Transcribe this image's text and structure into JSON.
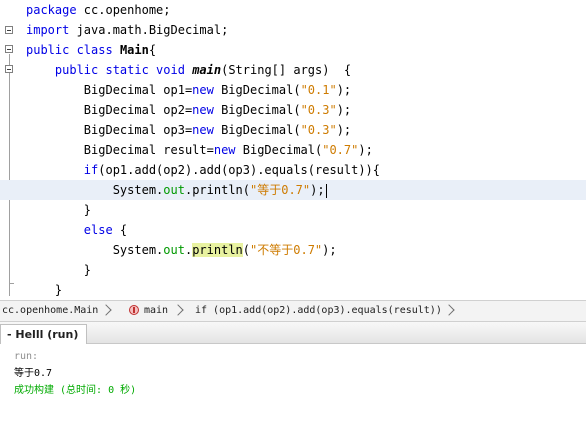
{
  "editor": {
    "lines": [
      {
        "parts": [
          {
            "t": "package",
            "c": "kw"
          },
          {
            "t": " cc.openhome;"
          }
        ]
      },
      {
        "parts": [
          {
            "t": "import",
            "c": "kw"
          },
          {
            "t": " java.math.BigDecimal;"
          }
        ]
      },
      {
        "parts": [
          {
            "t": "public class",
            "c": "kw"
          },
          {
            "t": " "
          },
          {
            "t": "Main",
            "c": "cls"
          },
          {
            "t": "{"
          }
        ]
      },
      {
        "parts": [
          {
            "t": "    public static void",
            "c": "kw"
          },
          {
            "t": " "
          },
          {
            "t": "main",
            "c": "fn"
          },
          {
            "t": "(String[] args)  {"
          }
        ]
      },
      {
        "parts": [
          {
            "t": "        BigDecimal op1="
          },
          {
            "t": "new",
            "c": "kw"
          },
          {
            "t": " BigDecimal("
          },
          {
            "t": "\"0.1\"",
            "c": "str"
          },
          {
            "t": ");"
          }
        ]
      },
      {
        "parts": [
          {
            "t": "        BigDecimal op2="
          },
          {
            "t": "new",
            "c": "kw"
          },
          {
            "t": " BigDecimal("
          },
          {
            "t": "\"0.3\"",
            "c": "str"
          },
          {
            "t": ");"
          }
        ]
      },
      {
        "parts": [
          {
            "t": "        BigDecimal op3="
          },
          {
            "t": "new",
            "c": "kw"
          },
          {
            "t": " BigDecimal("
          },
          {
            "t": "\"0.3\"",
            "c": "str"
          },
          {
            "t": ");"
          }
        ]
      },
      {
        "parts": [
          {
            "t": "        BigDecimal result="
          },
          {
            "t": "new",
            "c": "kw"
          },
          {
            "t": " BigDecimal("
          },
          {
            "t": "\"0.7\"",
            "c": "str"
          },
          {
            "t": ");"
          }
        ]
      },
      {
        "parts": [
          {
            "t": "        "
          },
          {
            "t": "if",
            "c": "kw"
          },
          {
            "t": "(op1.add(op2).add(op3).equals(result)){"
          }
        ]
      },
      {
        "parts": [
          {
            "t": "            System."
          },
          {
            "t": "out",
            "c": "fld"
          },
          {
            "t": ".println("
          },
          {
            "t": "\"等于0.7\"",
            "c": "str"
          },
          {
            "t": ");"
          }
        ],
        "current": true
      },
      {
        "parts": [
          {
            "t": "        }"
          }
        ]
      },
      {
        "parts": [
          {
            "t": "        "
          },
          {
            "t": "else",
            "c": "kw"
          },
          {
            "t": " {"
          }
        ]
      },
      {
        "parts": [
          {
            "t": "            System."
          },
          {
            "t": "out",
            "c": "fld"
          },
          {
            "t": "."
          },
          {
            "t": "println",
            "c": "hl"
          },
          {
            "t": "("
          },
          {
            "t": "\"不等于0.7\"",
            "c": "str"
          },
          {
            "t": ");"
          }
        ]
      },
      {
        "parts": [
          {
            "t": "        }"
          }
        ]
      },
      {
        "parts": [
          {
            "t": "    }"
          }
        ]
      }
    ]
  },
  "breadcrumb": {
    "class_label": "cc.openhome.Main",
    "method_label": "main",
    "statement_label": "if (op1.add(op2).add(op3).equals(result))"
  },
  "output": {
    "tab_label": "- Helll (run)",
    "run_label": "run:",
    "result_text": "等于0.7",
    "build_text": "成功构建 (总时间: 0 秒)"
  },
  "icons": {
    "fold": "code-fold-icon",
    "method": "method-icon",
    "separator": "chevron-right-icon"
  }
}
